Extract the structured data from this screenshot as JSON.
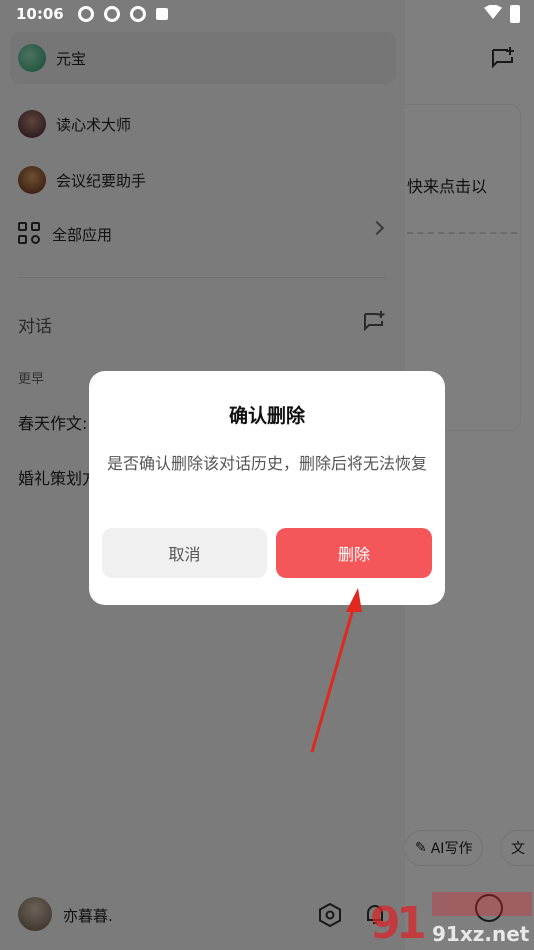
{
  "status_bar": {
    "time": "10:06"
  },
  "main": {
    "snippet": "快来点击以",
    "chips": {
      "ai_write": "AI写作",
      "translate": ""
    }
  },
  "sidebar": {
    "top_app": {
      "name": "元宝"
    },
    "apps": [
      {
        "name": "读心术大师"
      },
      {
        "name": "会议纪要助手"
      }
    ],
    "all_apps_label": "全部应用",
    "conversations_title": "对话",
    "section_label": "更早",
    "conversations": [
      {
        "title": "春天作文:"
      },
      {
        "title": "婚礼策划方"
      }
    ],
    "user": {
      "name": "亦暮暮."
    }
  },
  "dialog": {
    "title": "确认删除",
    "message": "是否确认删除该对话历史，删除后将无法恢复",
    "cancel_label": "取消",
    "delete_label": "删除"
  },
  "colors": {
    "delete_button": "#f5565a",
    "cancel_button": "#f0f0f0",
    "annotation_arrow": "#e0281e"
  },
  "watermark": {
    "text": "91xz.net"
  }
}
